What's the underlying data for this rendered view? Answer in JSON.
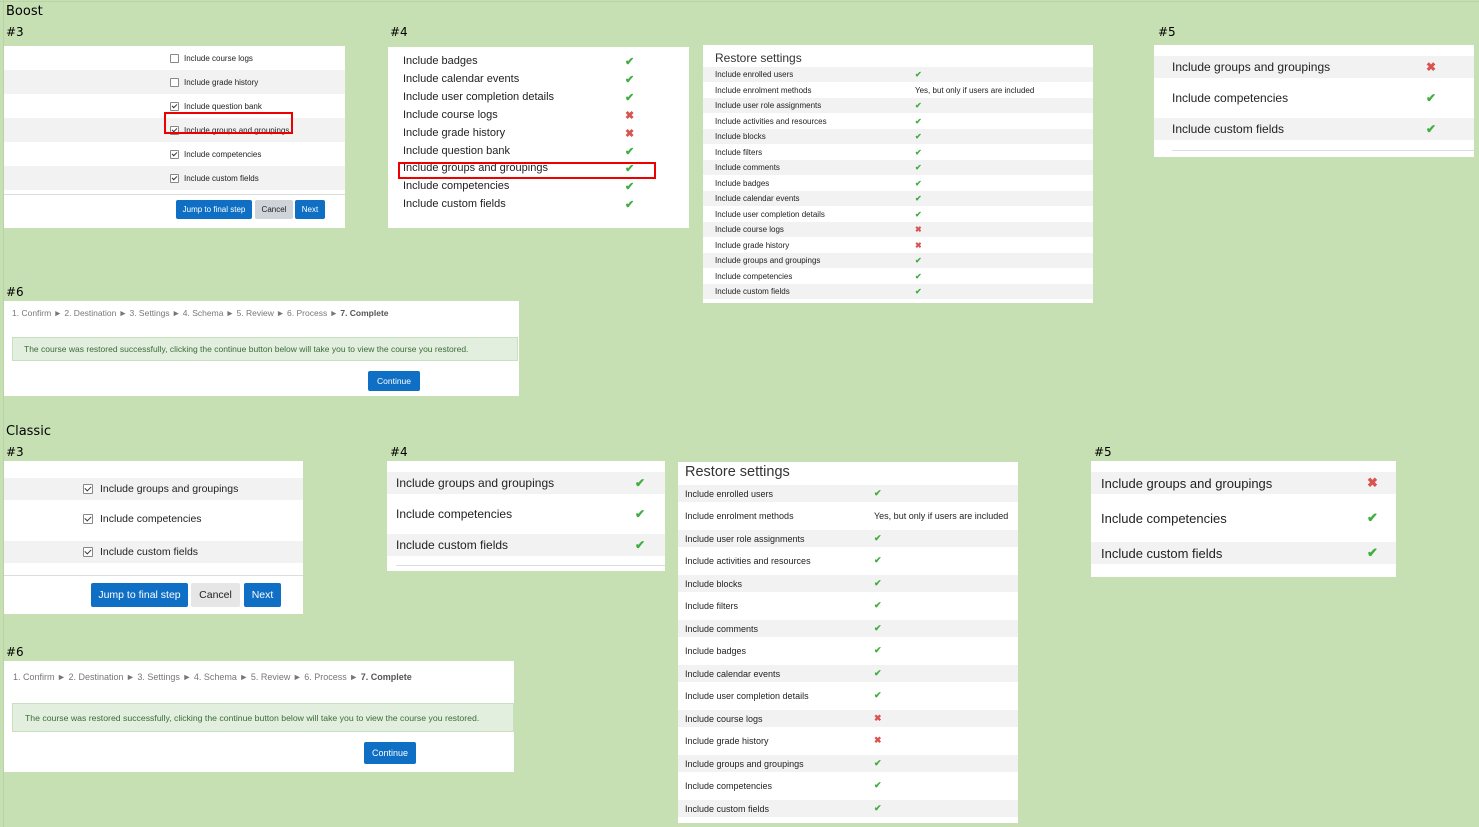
{
  "boost": {
    "title": "Boost",
    "s3": {
      "label": "#3",
      "items": [
        {
          "label": "Include course logs",
          "checked": false
        },
        {
          "label": "Include grade history",
          "checked": false
        },
        {
          "label": "Include question bank",
          "checked": true
        },
        {
          "label": "Include groups and groupings",
          "checked": true
        },
        {
          "label": "Include competencies",
          "checked": true
        },
        {
          "label": "Include custom fields",
          "checked": true
        }
      ],
      "buttons": {
        "jump": "Jump to final step",
        "cancel": "Cancel",
        "next": "Next"
      }
    },
    "s4": {
      "label": "#4",
      "items": [
        {
          "label": "Include badges",
          "status": "yes"
        },
        {
          "label": "Include calendar events",
          "status": "yes"
        },
        {
          "label": "Include user completion details",
          "status": "yes"
        },
        {
          "label": "Include course logs",
          "status": "no"
        },
        {
          "label": "Include grade history",
          "status": "no"
        },
        {
          "label": "Include question bank",
          "status": "yes"
        },
        {
          "label": "Include groups and groupings",
          "status": "yes"
        },
        {
          "label": "Include competencies",
          "status": "yes"
        },
        {
          "label": "Include custom fields",
          "status": "yes"
        }
      ]
    },
    "restore": {
      "title": "Restore settings",
      "items": [
        {
          "label": "Include enrolled users",
          "status": "yes"
        },
        {
          "label": "Include enrolment methods",
          "status": "text",
          "text": "Yes, but only if users are included"
        },
        {
          "label": "Include user role assignments",
          "status": "yes"
        },
        {
          "label": "Include activities and resources",
          "status": "yes"
        },
        {
          "label": "Include blocks",
          "status": "yes"
        },
        {
          "label": "Include filters",
          "status": "yes"
        },
        {
          "label": "Include comments",
          "status": "yes"
        },
        {
          "label": "Include badges",
          "status": "yes"
        },
        {
          "label": "Include calendar events",
          "status": "yes"
        },
        {
          "label": "Include user completion details",
          "status": "yes"
        },
        {
          "label": "Include course logs",
          "status": "no"
        },
        {
          "label": "Include grade history",
          "status": "no"
        },
        {
          "label": "Include groups and groupings",
          "status": "yes"
        },
        {
          "label": "Include competencies",
          "status": "yes"
        },
        {
          "label": "Include custom fields",
          "status": "yes"
        }
      ]
    },
    "s5": {
      "label": "#5",
      "items": [
        {
          "label": "Include groups and groupings",
          "status": "no"
        },
        {
          "label": "Include competencies",
          "status": "yes"
        },
        {
          "label": "Include custom fields",
          "status": "yes"
        }
      ]
    },
    "s6": {
      "label": "#6",
      "steps": [
        "1. Confirm",
        "2. Destination",
        "3. Settings",
        "4. Schema",
        "5. Review",
        "6. Process",
        "7. Complete"
      ],
      "message": "The course was restored successfully, clicking the continue button below will take you to view the course you restored.",
      "continue": "Continue"
    }
  },
  "classic": {
    "title": "Classic",
    "s3": {
      "label": "#3",
      "items": [
        {
          "label": "Include groups and groupings",
          "checked": true
        },
        {
          "label": "Include competencies",
          "checked": true
        },
        {
          "label": "Include custom fields",
          "checked": true
        }
      ],
      "buttons": {
        "jump": "Jump to final step",
        "cancel": "Cancel",
        "next": "Next"
      }
    },
    "s4": {
      "label": "#4",
      "items": [
        {
          "label": "Include groups and groupings",
          "status": "yes"
        },
        {
          "label": "Include competencies",
          "status": "yes"
        },
        {
          "label": "Include custom fields",
          "status": "yes"
        }
      ]
    },
    "restore": {
      "title": "Restore settings",
      "items": [
        {
          "label": "Include enrolled users",
          "status": "yes"
        },
        {
          "label": "Include enrolment methods",
          "status": "text",
          "text": "Yes, but only if users are included"
        },
        {
          "label": "Include user role assignments",
          "status": "yes"
        },
        {
          "label": "Include activities and resources",
          "status": "yes"
        },
        {
          "label": "Include blocks",
          "status": "yes"
        },
        {
          "label": "Include filters",
          "status": "yes"
        },
        {
          "label": "Include comments",
          "status": "yes"
        },
        {
          "label": "Include badges",
          "status": "yes"
        },
        {
          "label": "Include calendar events",
          "status": "yes"
        },
        {
          "label": "Include user completion details",
          "status": "yes"
        },
        {
          "label": "Include course logs",
          "status": "no"
        },
        {
          "label": "Include grade history",
          "status": "no"
        },
        {
          "label": "Include groups and groupings",
          "status": "yes"
        },
        {
          "label": "Include competencies",
          "status": "yes"
        },
        {
          "label": "Include custom fields",
          "status": "yes"
        }
      ]
    },
    "s5": {
      "label": "#5",
      "items": [
        {
          "label": "Include groups and groupings",
          "status": "no"
        },
        {
          "label": "Include competencies",
          "status": "yes"
        },
        {
          "label": "Include custom fields",
          "status": "yes"
        }
      ]
    },
    "s6": {
      "label": "#6",
      "steps": [
        "1. Confirm",
        "2. Destination",
        "3. Settings",
        "4. Schema",
        "5. Review",
        "6. Process",
        "7. Complete"
      ],
      "message": "The course was restored successfully, clicking the continue button below will take you to view the course you restored.",
      "continue": "Continue"
    }
  },
  "colors": {
    "sheet_background": "#c6e0b4",
    "primary_button": "#0f6fc5",
    "tick": "#3fae3f",
    "cross": "#d9534f",
    "highlight": "#e00000",
    "alert_background": "#e3efde"
  }
}
